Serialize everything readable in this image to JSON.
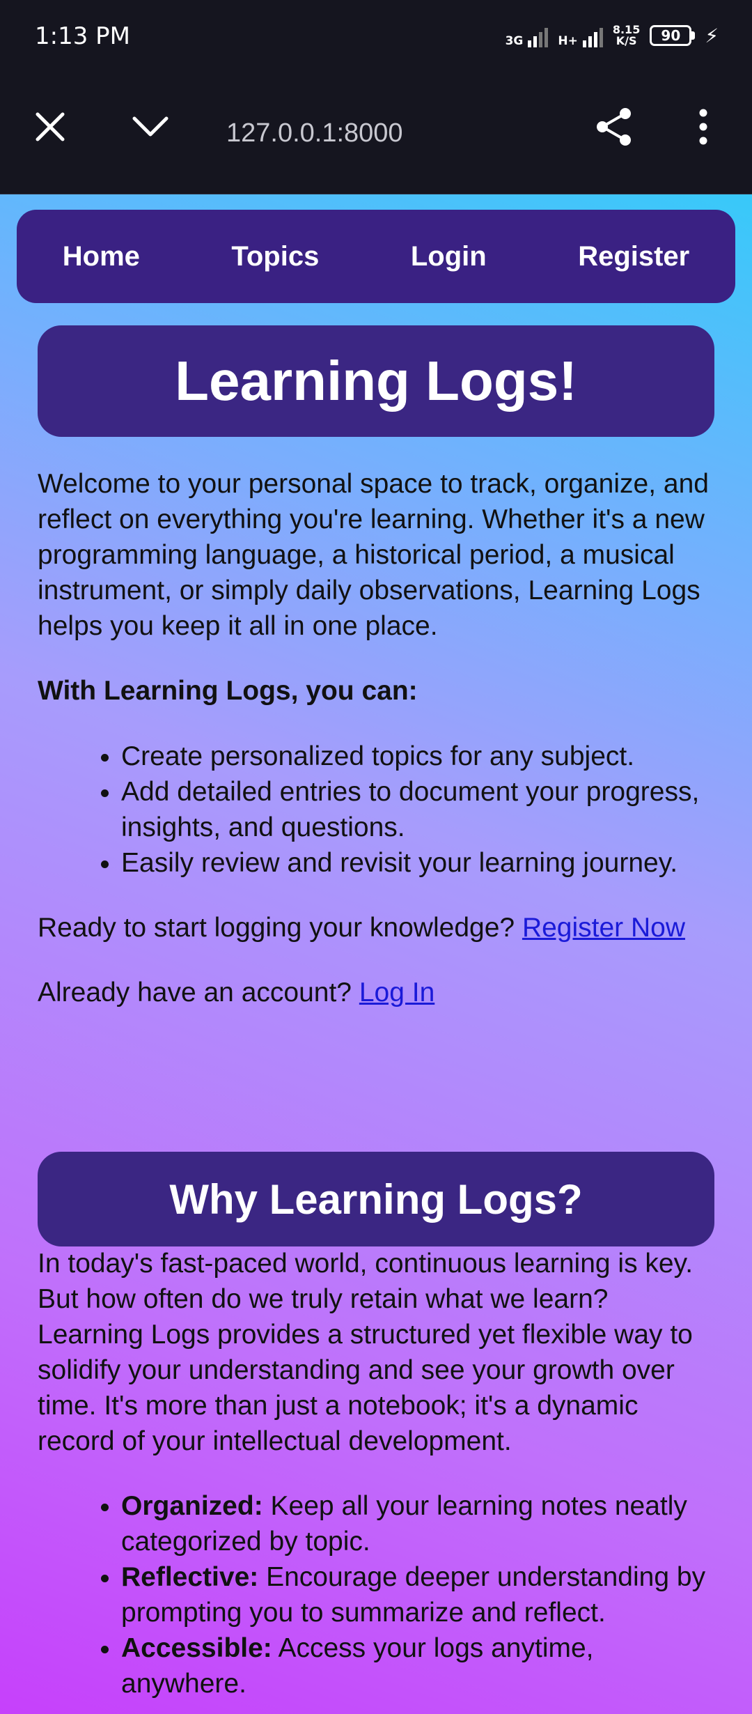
{
  "status_bar": {
    "time": "1:13 PM",
    "network1": "3G",
    "network2": "H+",
    "speed_value": "8.15",
    "speed_unit": "K/S",
    "battery": "90"
  },
  "browser": {
    "url": "127.0.0.1:8000"
  },
  "nav": {
    "items": [
      "Home",
      "Topics",
      "Login",
      "Register"
    ]
  },
  "main": {
    "title": "Learning Logs!",
    "intro": "Welcome to your personal space to track, organize, and reflect on everything you're learning. Whether it's a new programming language, a historical period, a musical instrument, or simply daily observations, Learning Logs helps you keep it all in one place.",
    "features_heading": "With Learning Logs, you can:",
    "features": [
      "Create personalized topics for any subject.",
      "Add detailed entries to document your progress, insights, and questions.",
      "Easily review and revisit your learning journey."
    ],
    "register_prompt": "Ready to start logging your knowledge?",
    "register_link": "Register Now",
    "login_prompt": "Already have an account?",
    "login_link": "Log In"
  },
  "why": {
    "title": "Why Learning Logs?",
    "body": "In today's fast-paced world, continuous learning is key. But how often do we truly retain what we learn? Learning Logs provides a structured yet flexible way to solidify your understanding and see your growth over time. It's more than just a notebook; it's a dynamic record of your intellectual development.",
    "points": [
      {
        "label": "Organized:",
        "text": "Keep all your learning notes neatly categorized by topic."
      },
      {
        "label": "Reflective:",
        "text": "Encourage deeper understanding by prompting you to summarize and reflect."
      },
      {
        "label": "Accessible:",
        "text": "Access your logs anytime, anywhere."
      }
    ]
  },
  "colors": {
    "nav_bg": "#3a2183",
    "link": "#1a1ad8",
    "gradient_top": "#38c9f9",
    "gradient_bottom": "#c640fb"
  }
}
